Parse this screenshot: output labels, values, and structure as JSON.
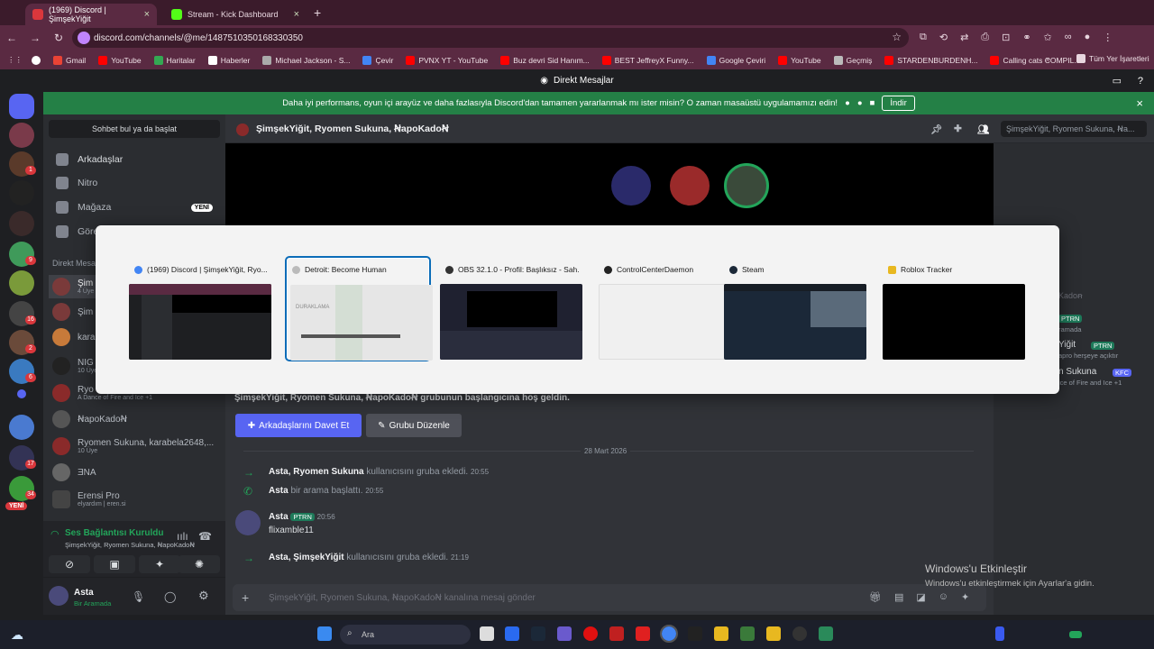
{
  "browser": {
    "tabs": [
      {
        "title": "(1969) Discord | ŞimşekYiğit",
        "active": true
      },
      {
        "title": "Stream - Kick Dashboard",
        "active": false
      }
    ],
    "url": "discord.com/channels/@me/1487510350168330350",
    "bookmarks": [
      "Gmail",
      "YouTube",
      "Haritalar",
      "Haberler",
      "Michael Jackson - S...",
      "Çevir",
      "PVNX YT - YouTube",
      "Buz devri Sid Hanım...",
      "BEST JeffreyX Funny...",
      "Google Çeviri",
      "YouTube",
      "Geçmiş",
      "STARDENBURDENH...",
      "Calling cats COMPIL..."
    ],
    "all_bookmarks": "Tüm Yer İşaretleri"
  },
  "discord": {
    "title": "Direkt Mesajlar",
    "banner": {
      "text": "Daha iyi performans, oyun içi arayüz ve daha fazlasıyla Discord'dan tamamen yararlanmak mı ister misin? O zaman masaüstü uygulamamızı edin!",
      "download": "İndir"
    },
    "search_placeholder": "Sohbet bul ya da başlat",
    "nav": {
      "friends": "Arkadaşlar",
      "nitro": "Nitro",
      "shop": "Mağaza",
      "shop_badge": "YENİ",
      "quests": "Görev"
    },
    "dm_header": "Direkt Mesa",
    "dms": [
      {
        "name": "Şim",
        "sub": "4 Üye"
      },
      {
        "name": "Şim",
        "sub": ""
      },
      {
        "name": "kara",
        "sub": ""
      },
      {
        "name": "NIG",
        "sub": "10 Üye"
      },
      {
        "name": "Ryo",
        "sub": "A Dance of Fire and Ice +1"
      },
      {
        "name": "ꞤapoKadoꞤ",
        "sub": ""
      },
      {
        "name": "Ryomen Sukuna, karabela2648,...",
        "sub": "10 Üye"
      },
      {
        "name": "ƎNA",
        "sub": ""
      },
      {
        "name": "Erensi Pro",
        "sub": "elyardım | eren.si"
      }
    ],
    "voice": {
      "status": "Ses Bağlantısı Kuruldu",
      "channel": "ŞimşekYiğit, Ryomen Sukuna, ꞤapoKadoꞤ"
    },
    "user": {
      "name": "Asta",
      "status": "Bir Aramada"
    },
    "chat_title": "ŞimşekYiğit, Ryomen Sukuna, ꞤapoKadoꞤ",
    "chat_search": "ŞimşekYiğit, Ryomen Sukuna, Ꞥa...",
    "welcome": "ŞimşekYiğit, Ryomen Sukuna, ꞤapoKadoꞤ grubunun başlangıcına hoş geldin.",
    "invite_btn": "Arkadaşlarını Davet Et",
    "edit_btn": "Grubu Düzenle",
    "date_divider": "28 Mart 2026",
    "messages": [
      {
        "author": "Asta",
        "rest": ", Ryomen Sukuna",
        "text": " kullanıcısını gruba ekledi.",
        "time": "20:55"
      },
      {
        "author": "Asta",
        "text": " bir arama başlattı.",
        "time": "20:55"
      },
      {
        "author": "Asta",
        "tag": "PTRN",
        "time": "20:56",
        "body": "flixamble11"
      },
      {
        "author": "Asta",
        "rest": ", ŞimşekYiğit",
        "text": " kullanıcısını gruba ekledi.",
        "time": "21:19"
      }
    ],
    "composer_placeholder": "ŞimşekYiğit, Ryomen Sukuna, ꞤapoKadoꞤ kanalına mesaj gönder",
    "members": [
      {
        "name": "Kadoꞥ",
        "sub": ""
      },
      {
        "name": "PTRN",
        "sub": "ramada"
      },
      {
        "name": "Yiğit",
        "tag": "PTRN",
        "sub": "apro herşeye açıktır"
      },
      {
        "name": "n Sukuna",
        "tag": "KFC",
        "sub": "ice of Fire and Ice +1"
      }
    ]
  },
  "switcher": {
    "windows": [
      {
        "title": "(1969) Discord | ŞimşekYiğit, Ryo...",
        "selected": false
      },
      {
        "title": "Detroit: Become Human",
        "selected": true
      },
      {
        "title": "OBS 32.1.0 - Profil: Başlıksız - Sah...",
        "selected": false
      },
      {
        "title": "ControlCenterDaemon",
        "selected": false
      },
      {
        "title": "Steam",
        "selected": false
      },
      {
        "title": "Roblox Tracker",
        "selected": false
      }
    ],
    "detroit_overlay": "DURAKLAMA"
  },
  "windows": {
    "watermark_title": "Windows'u Etkinleştir",
    "watermark_sub": "Windows'u etkinleştirmek için Ayarlar'a gidin.",
    "taskbar_search": "Ara"
  },
  "colors": {
    "discord_green": "#248046",
    "blurple": "#5865f2",
    "browser_accent": "#5a2a42",
    "select_blue": "#0b6cb8"
  }
}
